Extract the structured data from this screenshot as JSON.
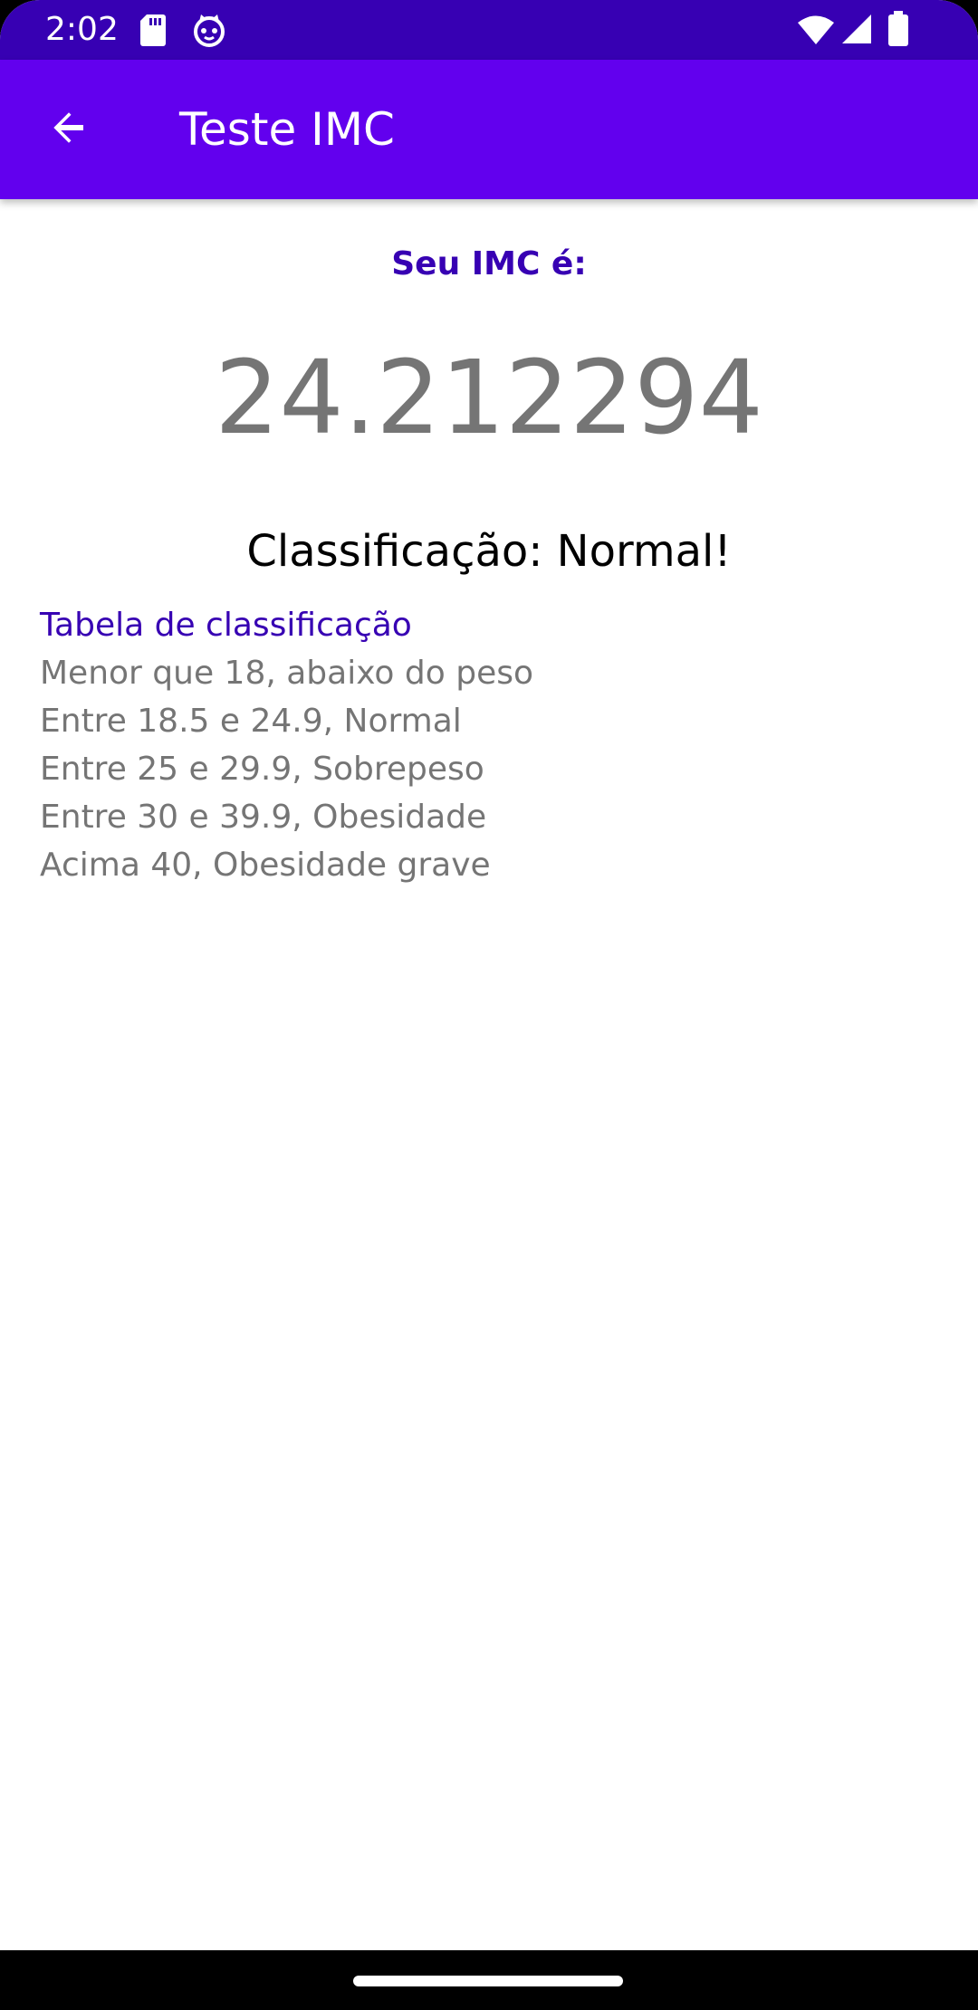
{
  "status_bar": {
    "time": "2:02",
    "icons": [
      "sd-card-icon",
      "cat-icon",
      "wifi-icon",
      "signal-icon",
      "battery-icon"
    ]
  },
  "app_bar": {
    "title": "Teste IMC",
    "back_icon": "arrow-back-icon"
  },
  "result": {
    "heading": "Seu IMC é:",
    "value": "24.212294",
    "classification": "Classificação: Normal!"
  },
  "table": {
    "title": "Tabela de classificação",
    "rows": [
      "Menor que 18, abaixo do peso",
      "Entre 18.5 e 24.9, Normal",
      "Entre 25 e 29.9, Sobrepeso",
      "Entre 30 e 39.9, Obesidade",
      "Acima 40, Obesidade grave"
    ]
  },
  "colors": {
    "status_bar": "#3700b3",
    "app_bar": "#6200ee",
    "accent_text": "#3700b3",
    "secondary_text": "#757575"
  }
}
